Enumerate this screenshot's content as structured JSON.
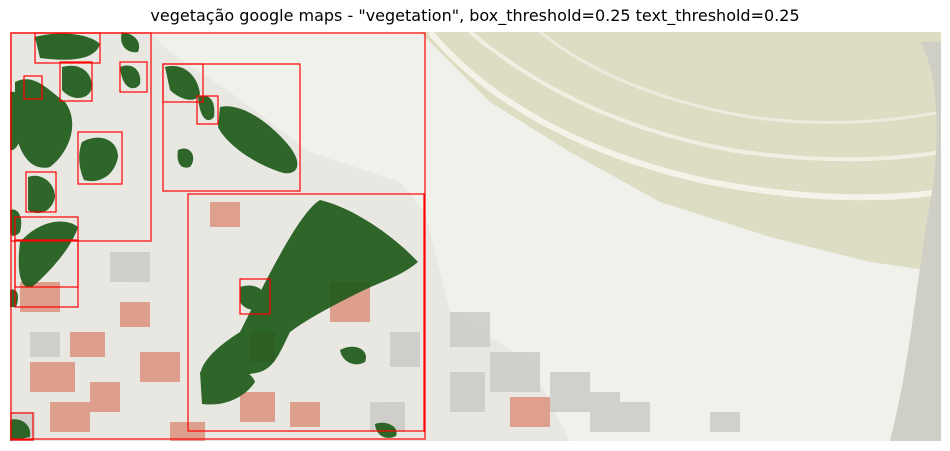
{
  "figure": {
    "title": "vegetação google maps - \"vegetation\", box_threshold=0.25 text_threshold=0.25"
  },
  "detection": {
    "prompt": "vegetation",
    "box_threshold": 0.25,
    "text_threshold": 0.25,
    "box_color": "#ff0000",
    "mask_color": "#1f5a1a",
    "box_count": 16
  },
  "scene": {
    "ocean_color": "#ddddc4",
    "sand_color": "#f1f1ec",
    "roof_color": "#d98770"
  }
}
